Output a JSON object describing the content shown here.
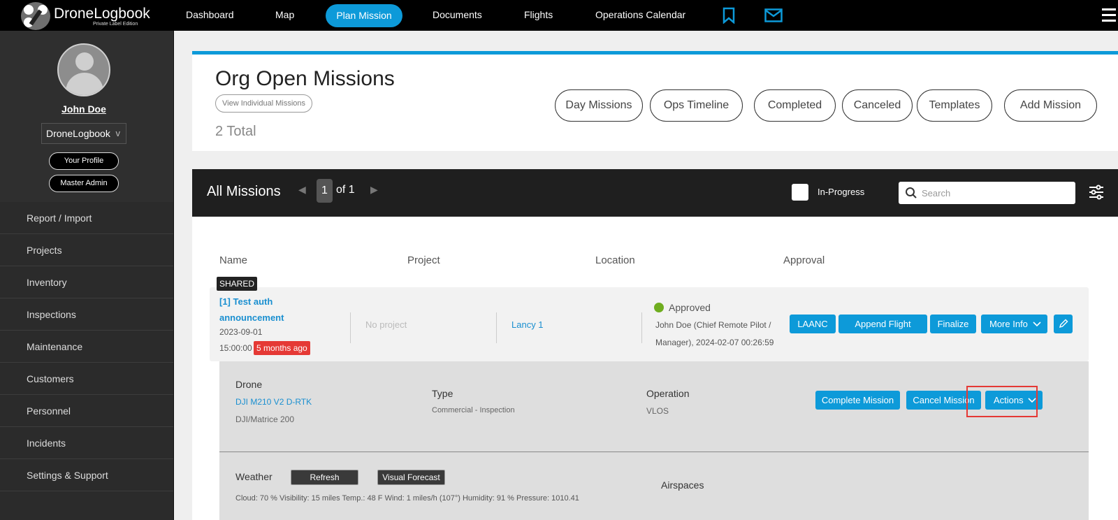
{
  "app": {
    "logo_text": "DroneLogbook",
    "logo_subtitle": "Private Label Edition"
  },
  "nav": {
    "items": [
      "Dashboard",
      "Map",
      "Plan Mission",
      "Documents",
      "Flights",
      "Operations Calendar"
    ],
    "active": "Plan Mission",
    "icons": [
      "bookmark-icon",
      "mail-icon",
      "hamburger-menu-icon"
    ]
  },
  "sidebar": {
    "user_name": "John Doe",
    "org": "DroneLogbook",
    "org_chevron": "v",
    "profile_button": "Your Profile",
    "admin_button": "Master Admin",
    "menu": [
      "Report / Import",
      "Projects",
      "Inventory",
      "Inspections",
      "Maintenance",
      "Customers",
      "Personnel",
      "Incidents",
      "Settings & Support"
    ]
  },
  "header": {
    "title": "Org Open Missions",
    "view_individual": "View Individual Missions",
    "total": "2 Total",
    "buttons": [
      "Day Missions",
      "Ops Timeline",
      "Completed",
      "Canceled",
      "Templates",
      "Add Mission"
    ]
  },
  "missions": {
    "title": "All Missions",
    "page": "1",
    "page_of": "of 1",
    "in_progress_label": "In-Progress",
    "in_progress_checked": false,
    "search_placeholder": "Search",
    "search_value": "",
    "columns": [
      "Name",
      "Project",
      "Location",
      "Approval"
    ],
    "accent_color": "#0d9ad9",
    "rows": [
      {
        "shared_badge": "SHARED",
        "name": "[1] Test auth announcement",
        "date": "2023-09-01",
        "time": "15:00:00",
        "age": "5 months ago",
        "project": "No project",
        "location": "Lancy 1",
        "approval_status": "Approved",
        "approval_status_color": "#6fad1f",
        "approval_by": "John Doe (Chief Remote Pilot / Manager), 2024-02-07 00:26:59",
        "buttons": [
          "LAANC",
          "Append Flight",
          "Finalize",
          "More Info"
        ],
        "edit_icon": "pencil-icon",
        "detail": {
          "drone_label": "Drone",
          "drone_name": "DJI M210 V2 D-RTK",
          "drone_model": "DJI/Matrice 200",
          "type_label": "Type",
          "type_value": "Commercial - Inspection",
          "operation_label": "Operation",
          "operation_value": "VLOS",
          "buttons": [
            "Complete Mission",
            "Cancel Mission",
            "Actions"
          ],
          "weather_label": "Weather",
          "refresh_button": "Refresh",
          "forecast_button": "Visual Forecast",
          "weather_summary": "Cloud: 70 %  Visibility: 15 miles  Temp.: 48 F  Wind: 1 miles/h (107°)  Humidity: 91 %  Pressure: 1010.41",
          "airspaces_label": "Airspaces"
        }
      }
    ]
  }
}
